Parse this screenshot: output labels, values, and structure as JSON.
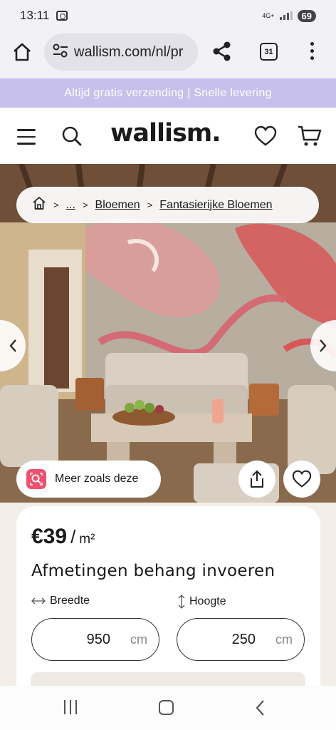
{
  "status_bar": {
    "time": "13:11",
    "network": "4G+",
    "battery": "69"
  },
  "browser": {
    "url": "wallism.com/nl/pr",
    "tab_count": "31"
  },
  "promo": {
    "text": "Altijd gratis verzending | Snelle levering"
  },
  "site": {
    "logo": "wallism."
  },
  "breadcrumb": {
    "sep": ">",
    "ellipsis": "...",
    "items": [
      "Bloemen",
      "Fantasierijke Bloemen"
    ]
  },
  "hero": {
    "more_like_label": "Meer zoals deze"
  },
  "product": {
    "price": "€39",
    "price_sep": "/",
    "unit": "m²",
    "heading": "Afmetingen behang invoeren",
    "width": {
      "label": "Breedte",
      "value": "950",
      "unit": "cm"
    },
    "height": {
      "label": "Hoogte",
      "value": "250",
      "unit": "cm"
    }
  },
  "colors": {
    "promo_bg": "#c8c0ec",
    "badge": "#f0506e"
  }
}
